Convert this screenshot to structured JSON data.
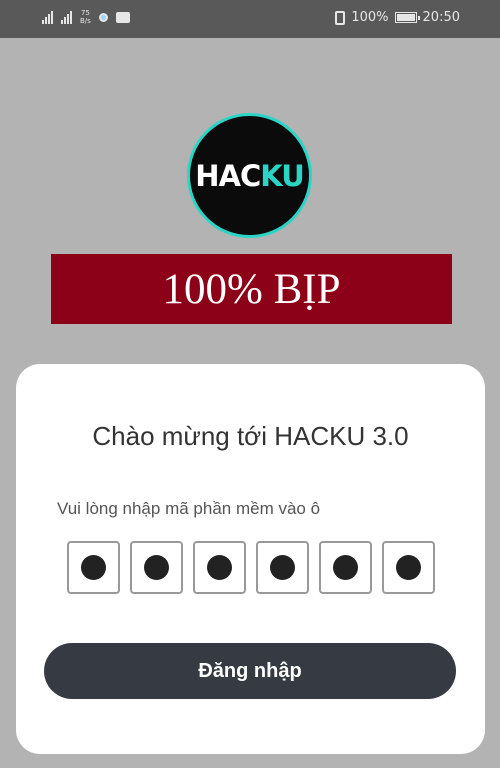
{
  "status_bar": {
    "network_label_top": "75",
    "network_label_bottom": "B/s",
    "battery": "100%",
    "time": "20:50",
    "icons": [
      "signal-icon",
      "signal-icon",
      "notification-dot-icon",
      "message-icon",
      "vibrate-icon",
      "battery-icon"
    ]
  },
  "logo": {
    "text_main": "HAC",
    "text_accent": "KU",
    "accent_color": "#2bd5c6"
  },
  "banner": {
    "text": "100% BỊP",
    "color": "#8c0018"
  },
  "card": {
    "title": "Chào mừng tới HACKU 3.0",
    "prompt": "Vui lòng nhập mã phần mềm vào ô",
    "code_boxes": [
      {
        "filled": true
      },
      {
        "filled": true
      },
      {
        "filled": true
      },
      {
        "filled": true
      },
      {
        "filled": true
      },
      {
        "filled": true
      }
    ],
    "login_label": "Đăng nhập",
    "button_color": "#363a42"
  }
}
